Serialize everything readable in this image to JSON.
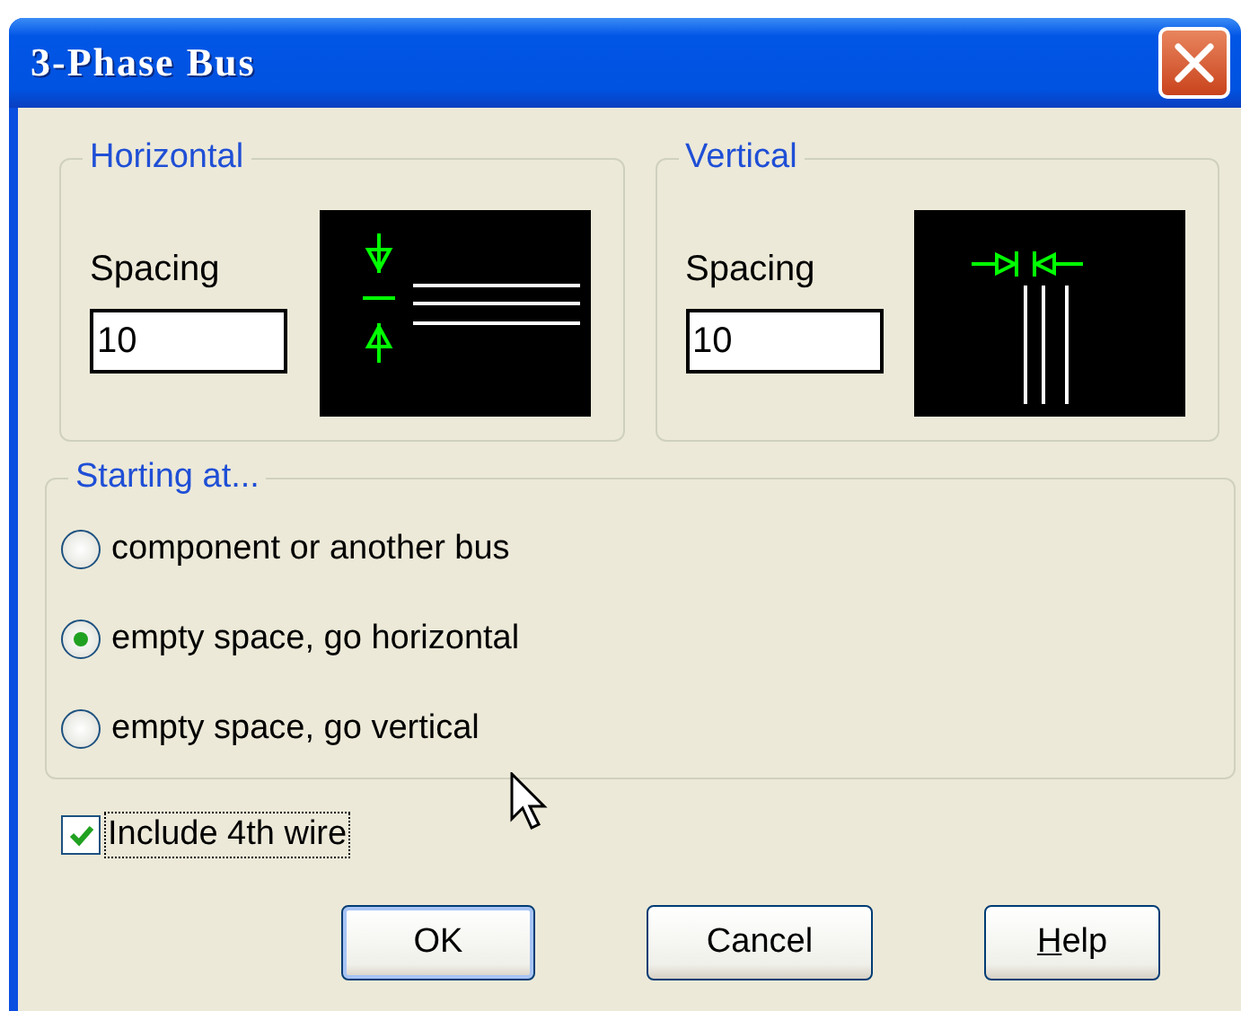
{
  "window": {
    "title": "3-Phase Bus"
  },
  "spacing_groups": [
    {
      "title": "Horizontal",
      "label": "Spacing",
      "value": "10",
      "kind": "horizontal"
    },
    {
      "title": "Vertical",
      "label": "Spacing",
      "value": "10",
      "kind": "vertical"
    }
  ],
  "starting_at": {
    "title": "Starting at...",
    "options": [
      {
        "label": "component or another bus",
        "selected": false
      },
      {
        "label": "empty space, go horizontal",
        "selected": true
      },
      {
        "label": "empty space, go vertical",
        "selected": false
      }
    ]
  },
  "include_4th_wire": {
    "label": "Include 4th wire",
    "checked": true,
    "focused": true
  },
  "buttons": [
    {
      "label": "OK",
      "default": true,
      "mnemonic_first": false
    },
    {
      "label": "Cancel",
      "default": false,
      "mnemonic_first": false
    },
    {
      "label": "Help",
      "default": false,
      "mnemonic_first": true
    }
  ]
}
